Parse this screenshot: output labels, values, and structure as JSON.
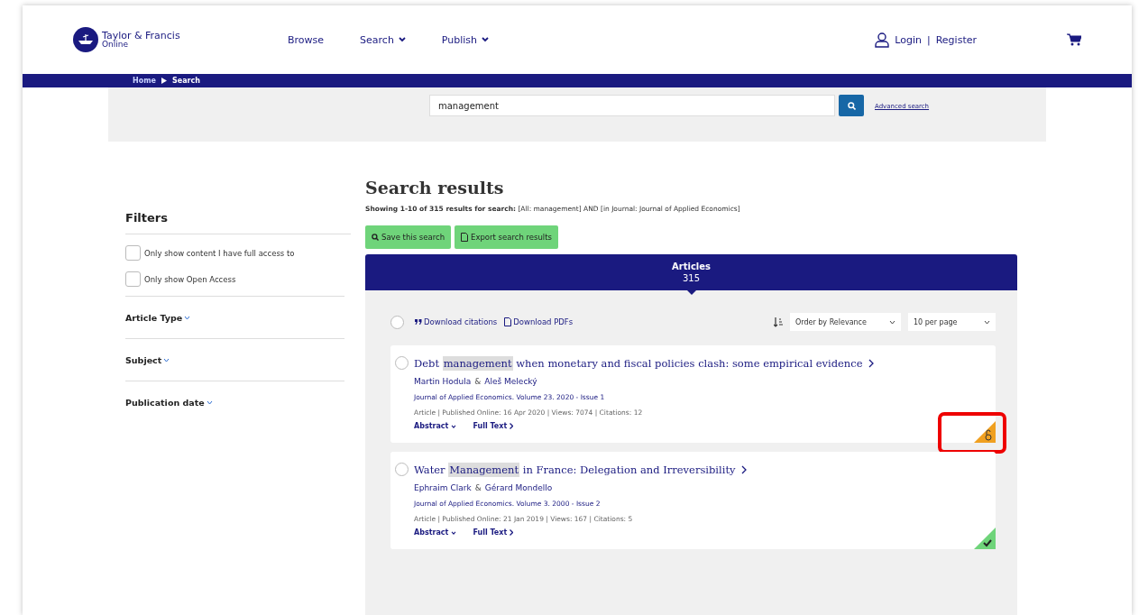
{
  "header": {
    "logo": {
      "line1": "Taylor & Francis",
      "line2": "Online"
    },
    "nav": [
      {
        "label": "Browse",
        "dropdown": false
      },
      {
        "label": "Search",
        "dropdown": true
      },
      {
        "label": "Publish",
        "dropdown": true
      }
    ],
    "login": "Login",
    "divider": "|",
    "register": "Register"
  },
  "breadcrumb": {
    "items": [
      "Home",
      "Search"
    ]
  },
  "search": {
    "value": "management",
    "advanced": "Advanced search"
  },
  "filters": {
    "title": "Filters",
    "checkboxes": [
      {
        "label": "Only show content I have full access to",
        "checked": false
      },
      {
        "label": "Only show Open Access",
        "checked": false
      }
    ],
    "sections": [
      {
        "label": "Article Type",
        "expanded": false
      },
      {
        "label": "Subject",
        "expanded": false
      },
      {
        "label": "Publication date",
        "expanded": false
      }
    ]
  },
  "results": {
    "title": "Search results",
    "summary": "**Showing 1-10 of 315 results for search:** [All: management] AND [in Journal: Journal of Applied Economics]",
    "actions": [
      "Save this search",
      "Export search results"
    ],
    "tab": {
      "label": "Articles",
      "count": "315"
    },
    "toolbar": {
      "select_all": false,
      "download_citations": "Download citations",
      "download_pdfs": "Download PDFs",
      "order": "Order by Relevance",
      "per_page": "10 per page"
    },
    "items": [
      {
        "selected": false,
        "title_parts": [
          {
            "text": "Debt ",
            "highlighted": false
          },
          {
            "text": "management",
            "highlighted": true
          },
          {
            "text": " when monetary and fiscal policies clash: some empirical evidence",
            "highlighted": false
          }
        ],
        "authors": [
          "Martin Hodula",
          "Aleš Melecký"
        ],
        "joiner": "&",
        "source": "Journal of Applied Economics. Volume 23. 2020 - Issue 1",
        "meta": "Article | Published Online: 16 Apr 2020 | Views: 7074 | Citations: 12",
        "abstract": "Abstract",
        "full_text": "Full Text",
        "kind": "open",
        "annotated": true
      },
      {
        "selected": false,
        "title_parts": [
          {
            "text": "Water ",
            "highlighted": false
          },
          {
            "text": "Management",
            "highlighted": true
          },
          {
            "text": " in France: Delegation and Irreversibility",
            "highlighted": false
          }
        ],
        "authors": [
          "Ephraim Clark",
          "Gérard Mondello"
        ],
        "joiner": "&",
        "source": "Journal of Applied Economics. Volume 3. 2000 - Issue 2",
        "meta": "Article | Published Online: 21 Jan 2019 | Views: 167 | Citations: 5",
        "abstract": "Abstract",
        "full_text": "Full Text",
        "kind": "full",
        "annotated": false
      }
    ]
  }
}
